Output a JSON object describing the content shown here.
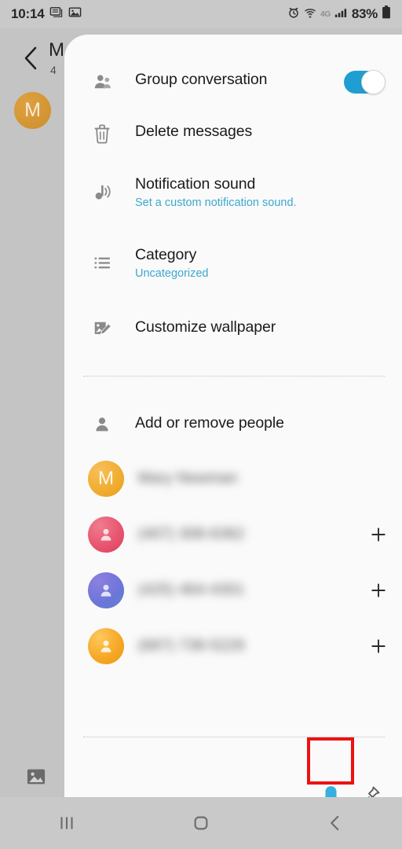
{
  "status_bar": {
    "time": "10:14",
    "battery_percent": "83%",
    "network": "4G",
    "icons": [
      "messages-icon",
      "gallery-icon",
      "alarm-icon",
      "wifi-icon",
      "network-4g-icon",
      "signal-bars-icon",
      "battery-icon"
    ]
  },
  "background_app": {
    "title": "M",
    "subtitle": "4",
    "avatar_letter": "M",
    "avatar_color": "#d8962f",
    "back_icon": "chevron-left-icon",
    "attachment_icon": "gallery-icon"
  },
  "sheet": {
    "menu": [
      {
        "icon": "group-people-icon",
        "label": "Group conversation",
        "sub": "",
        "toggle": true,
        "toggle_on": true
      },
      {
        "icon": "trash-icon",
        "label": "Delete messages",
        "sub": ""
      },
      {
        "icon": "music-note-icon",
        "label": "Notification sound",
        "sub": "Set a custom notification sound."
      },
      {
        "icon": "list-icon",
        "label": "Category",
        "sub": "Uncategorized"
      },
      {
        "icon": "image-edit-icon",
        "label": "Customize wallpaper",
        "sub": ""
      }
    ],
    "people_section": {
      "icon": "person-icon",
      "label": "Add or remove people"
    },
    "contacts": [
      {
        "avatar_letter": "M",
        "avatar_color": "#f0ab2e",
        "name": "Mary Newman",
        "redacted": true,
        "has_add": false
      },
      {
        "avatar_letter": "",
        "avatar_color": "#e8536f",
        "name": "(407) 308-6362",
        "redacted": true,
        "has_add": true,
        "add_label": "+"
      },
      {
        "avatar_letter": "",
        "avatar_color": "#6b76d8",
        "name": "(425) 464-4301",
        "redacted": true,
        "has_add": true,
        "add_label": "+"
      },
      {
        "avatar_letter": "",
        "avatar_color": "#f5a623",
        "name": "(667) 738-5229",
        "redacted": true,
        "has_add": true,
        "add_label": "+"
      }
    ],
    "actions": [
      {
        "icon": "bell-icon",
        "name": "notification-toggle",
        "color": "#36b0e0",
        "highlighted": true
      },
      {
        "icon": "pin-icon",
        "name": "pin-conversation",
        "color": "#5a5a5a",
        "highlighted": false
      }
    ]
  },
  "annotation": {
    "type": "highlight-rectangle",
    "color": "#ee1111",
    "target": "bell-icon"
  },
  "nav_bar": {
    "buttons": [
      {
        "icon": "recents-icon",
        "name": "recents-button"
      },
      {
        "icon": "home-icon",
        "name": "home-button"
      },
      {
        "icon": "back-icon",
        "name": "back-button"
      }
    ]
  },
  "colors": {
    "accent_blue": "#3ba8cf",
    "toggle_on": "#1f9ed1",
    "bell_blue": "#36b0e0",
    "annotation_red": "#ee1111",
    "sheet_bg": "#fafafa",
    "screen_bg": "#c9c9c9"
  }
}
